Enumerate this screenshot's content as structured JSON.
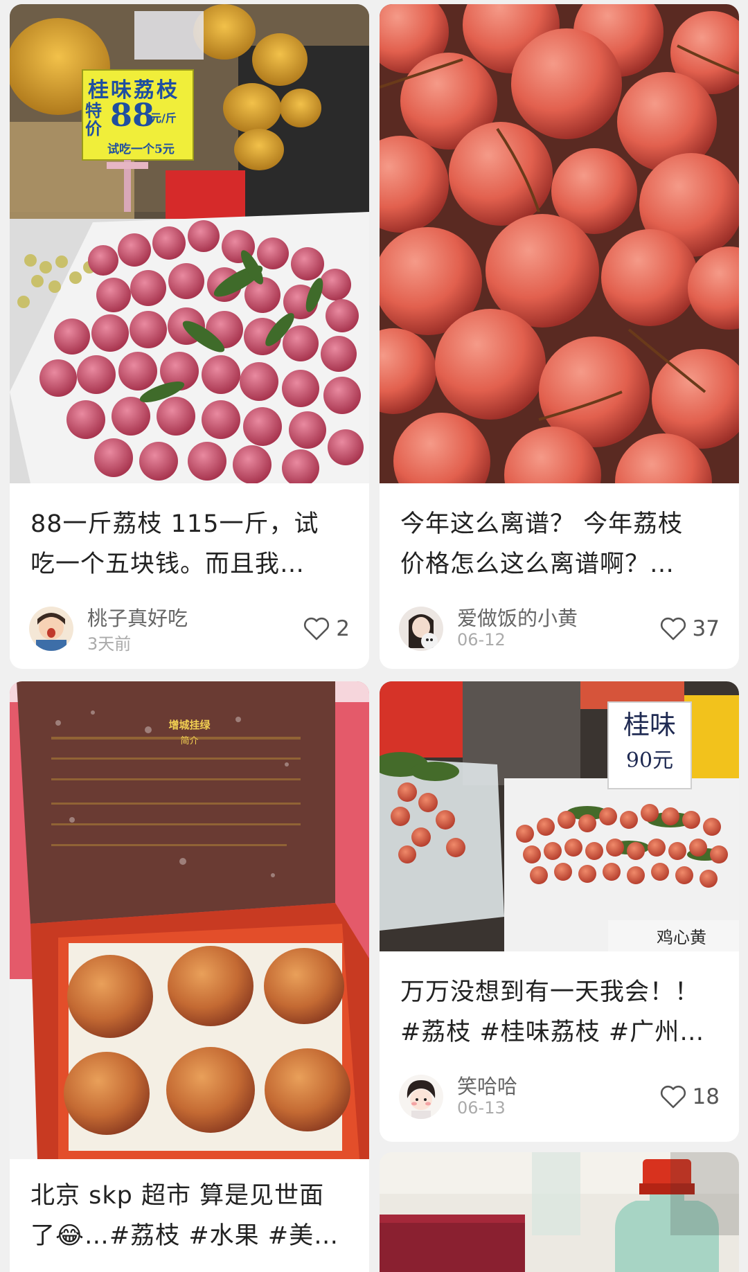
{
  "feed": {
    "posts": [
      {
        "caption_line1": "88一斤荔枝 115一斤，试",
        "caption_line2": "吃一个五块钱。而且我…",
        "author": "桃子真好吃",
        "date": "3天前",
        "likes": "2",
        "image": {
          "sign_title": "桂味荔枝",
          "sign_left": "特价",
          "sign_price": "88",
          "sign_unit": "元/斤",
          "sign_bottom": "试吃一个5元"
        }
      },
      {
        "caption_line1": "今年这么离谱？ 今年荔枝",
        "caption_line2": "价格怎么这么离谱啊？…",
        "author": "爱做饭的小黄",
        "date": "06-12",
        "likes": "37"
      },
      {
        "caption_line1": "北京 skp 超市 算是见世面",
        "caption_line2": "了😂…#荔枝 #水果 #美…",
        "image": {
          "box_title": "增城挂绿",
          "box_subtitle": "简介"
        }
      },
      {
        "caption_line1": "万万没想到有一天我会！！",
        "caption_line2": "#荔枝 #桂味荔枝 #广州…",
        "author": "笑哈哈",
        "date": "06-13",
        "likes": "18",
        "image": {
          "sign_line1": "桂味",
          "sign_line2": "90元",
          "side_sign": "鸡心黄"
        }
      },
      {
        "caption_line1": "",
        "caption_line2": ""
      }
    ]
  },
  "colors": {
    "background": "#f0f0f0",
    "card": "#ffffff",
    "text": "#222222",
    "muted": "#aaaaaa",
    "author": "#666666"
  },
  "icons": {
    "like": "heart-outline-icon"
  }
}
